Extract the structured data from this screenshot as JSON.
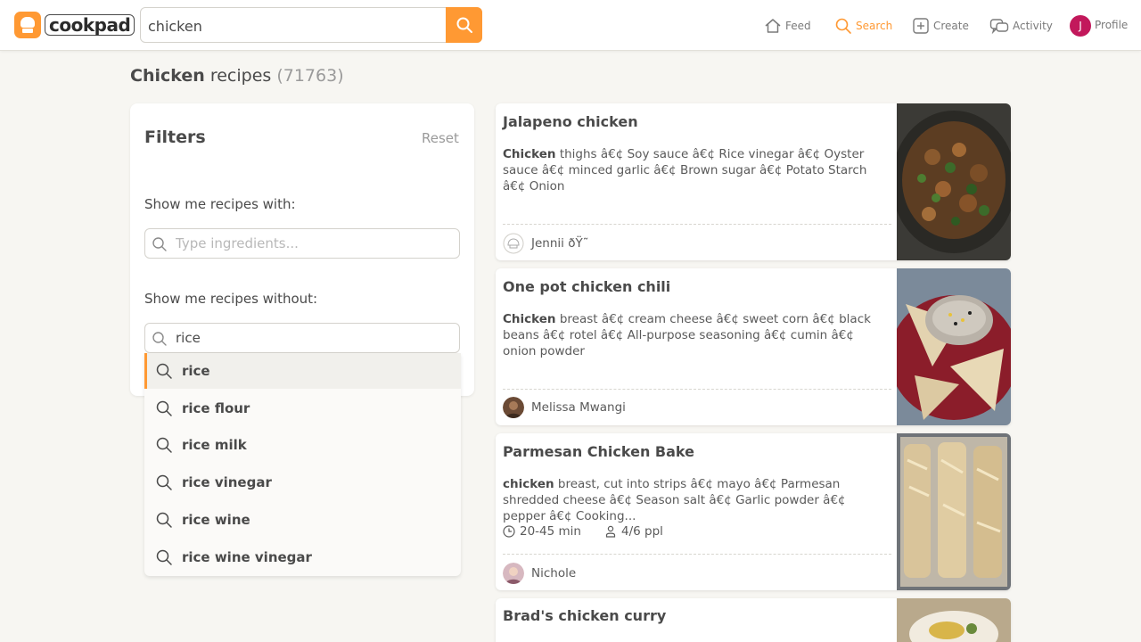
{
  "header": {
    "logo_text": "cookpad",
    "search_value": "chicken",
    "nav": [
      {
        "label": "Feed",
        "icon": "home-icon"
      },
      {
        "label": "Search",
        "icon": "search-icon"
      },
      {
        "label": "Create",
        "icon": "plus-icon"
      },
      {
        "label": "Activity",
        "icon": "chat-icon"
      }
    ],
    "avatar_initial": "J",
    "profile_label": "Profile",
    "accent_color": "#ff9933"
  },
  "page_title": {
    "keyword": "Chicken",
    "rest": " recipes ",
    "count": "(71763)"
  },
  "filters": {
    "title": "Filters",
    "reset_label": "Reset",
    "with_label": "Show me recipes with:",
    "with_placeholder": "Type ingredients...",
    "without_label": "Show me recipes without:",
    "without_value": "rice"
  },
  "suggestions": [
    "rice",
    "rice flour",
    "rice milk",
    "rice vinegar",
    "rice wine",
    "rice wine vinegar"
  ],
  "recipes": [
    {
      "title": "Jalapeno chicken",
      "ing_first": "Chicken",
      "ing_rest": " thighs â€¢ Soy sauce â€¢ Rice vinegar â€¢ Oyster sauce â€¢ minced garlic â€¢ Brown sugar â€¢ Potato Starch â€¢ Onion",
      "author": "Jennii ðŸ˜"
    },
    {
      "title": "One pot chicken chili",
      "ing_first": "Chicken",
      "ing_rest": " breast â€¢ cream cheese â€¢ sweet corn â€¢ black beans â€¢ rotel â€¢ All-purpose seasoning â€¢ cumin â€¢ onion powder",
      "author": "Melissa Mwangi"
    },
    {
      "title": "Parmesan Chicken Bake",
      "ing_first": "chicken",
      "ing_rest": " breast, cut into strips â€¢ mayo â€¢ Parmesan shredded cheese â€¢ Season salt â€¢ Garlic powder â€¢ pepper â€¢ Cooking...",
      "time": "20-45 min",
      "servings": "4/6 ppl",
      "author": "Nichole"
    },
    {
      "title": "Brad's chicken curry"
    }
  ]
}
